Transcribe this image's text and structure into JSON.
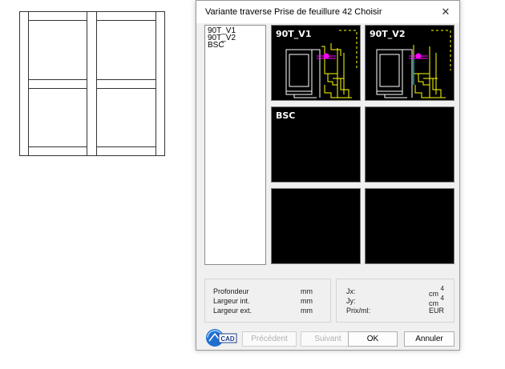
{
  "dialog": {
    "title": "Variante traverse Prise de feuillure 42 Choisir",
    "close_glyph": "✕"
  },
  "variant_list": [
    "90T_V1",
    "90T_V2",
    "BSC"
  ],
  "tiles": [
    {
      "label": "90T_V1"
    },
    {
      "label": "90T_V2"
    },
    {
      "label": "BSC"
    },
    {
      "label": ""
    },
    {
      "label": ""
    },
    {
      "label": ""
    }
  ],
  "properties_left": [
    {
      "label": "Profondeur",
      "unit": "mm"
    },
    {
      "label": "Largeur int.",
      "unit": "mm"
    },
    {
      "label": "Largeur ext.",
      "unit": "mm"
    }
  ],
  "properties_right": [
    {
      "label": "Jx:",
      "unit": "cm",
      "exp": "4"
    },
    {
      "label": "Jy:",
      "unit": "cm",
      "exp": "4"
    },
    {
      "label": "Prix/ml:",
      "unit": "EUR",
      "exp": ""
    }
  ],
  "buttons": {
    "previous": "Précédent",
    "next": "Suivant",
    "ok": "OK",
    "cancel": "Annuler"
  },
  "logo_text": "CAD",
  "colors": {
    "tile_bg": "#000000",
    "drawing_line": "#ffffff",
    "drawing_accent": "#ffff00",
    "drawing_marker": "#ff00ff",
    "drawing_cyan": "#00ffff"
  }
}
